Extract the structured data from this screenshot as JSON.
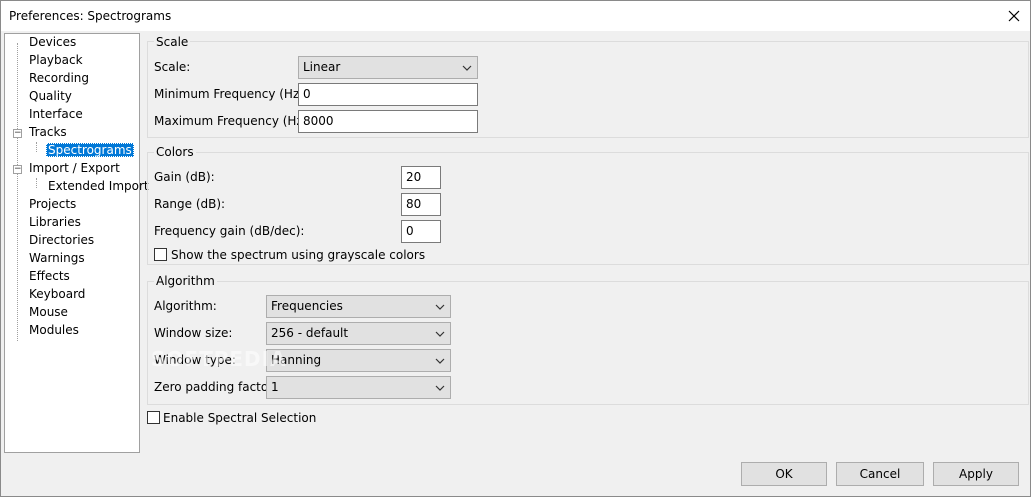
{
  "window": {
    "title": "Preferences: Spectrograms"
  },
  "tree": {
    "items": [
      {
        "label": "Devices"
      },
      {
        "label": "Playback"
      },
      {
        "label": "Recording"
      },
      {
        "label": "Quality"
      },
      {
        "label": "Interface"
      },
      {
        "label": "Tracks",
        "expander": "−"
      },
      {
        "label": "Spectrograms",
        "selected": true
      },
      {
        "label": "Import / Export",
        "expander": "−"
      },
      {
        "label": "Extended Import"
      },
      {
        "label": "Projects"
      },
      {
        "label": "Libraries"
      },
      {
        "label": "Directories"
      },
      {
        "label": "Warnings"
      },
      {
        "label": "Effects"
      },
      {
        "label": "Keyboard"
      },
      {
        "label": "Mouse"
      },
      {
        "label": "Modules"
      }
    ]
  },
  "scale": {
    "title": "Scale",
    "scale_label": "Scale:",
    "scale_value": "Linear",
    "min_freq_label": "Minimum Frequency (Hz):",
    "min_freq_value": "0",
    "max_freq_label": "Maximum Frequency (Hz):",
    "max_freq_value": "8000"
  },
  "colors": {
    "title": "Colors",
    "gain_label": "Gain (dB):",
    "gain_value": "20",
    "range_label": "Range (dB):",
    "range_value": "80",
    "freq_gain_label": "Frequency gain (dB/dec):",
    "freq_gain_value": "0",
    "grayscale_label": "Show the spectrum using grayscale colors",
    "grayscale_checked": false
  },
  "algorithm": {
    "title": "Algorithm",
    "algorithm_label": "Algorithm:",
    "algorithm_value": "Frequencies",
    "window_size_label": "Window size:",
    "window_size_value": "256 - default",
    "window_type_label": "Window type:",
    "window_type_value": "Hanning",
    "zero_padding_label": "Zero padding factor:",
    "zero_padding_value": "1"
  },
  "spectral_selection": {
    "label": "Enable Spectral Selection",
    "checked": false
  },
  "buttons": {
    "ok": "OK",
    "cancel": "Cancel",
    "apply": "Apply"
  },
  "watermark": "SOFTPEDIA",
  "icons": {
    "close": "close-icon",
    "dropdown": "chevron-down-icon"
  }
}
